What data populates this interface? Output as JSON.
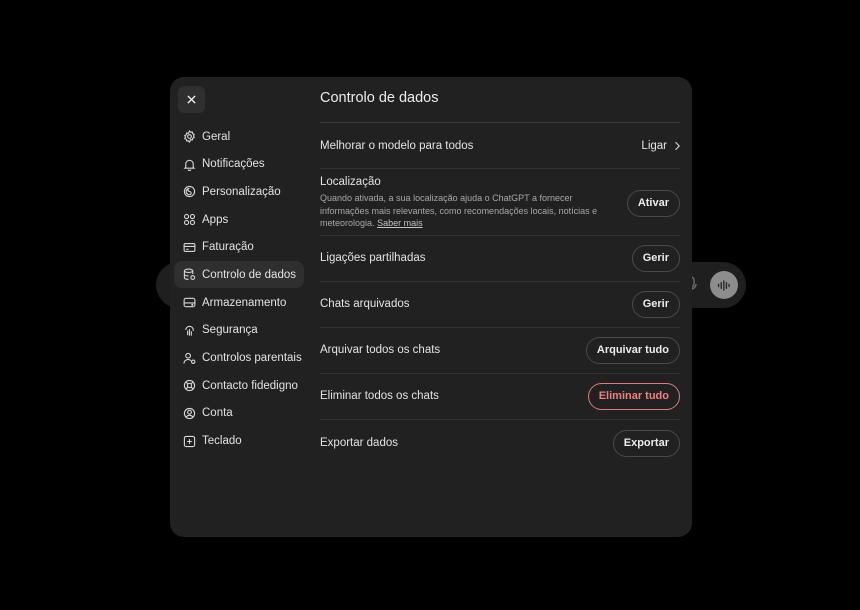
{
  "modal": {
    "title": "Controlo de dados"
  },
  "sidebar": {
    "items": [
      {
        "label": "Geral",
        "icon": "gear-icon"
      },
      {
        "label": "Notificações",
        "icon": "bell-icon"
      },
      {
        "label": "Personalização",
        "icon": "personalization-icon"
      },
      {
        "label": "Apps",
        "icon": "apps-grid-icon"
      },
      {
        "label": "Faturação",
        "icon": "credit-card-icon"
      },
      {
        "label": "Controlo de dados",
        "icon": "database-icon",
        "active": true
      },
      {
        "label": "Armazenamento",
        "icon": "storage-icon"
      },
      {
        "label": "Segurança",
        "icon": "security-icon"
      },
      {
        "label": "Controlos parentais",
        "icon": "parental-icon"
      },
      {
        "label": "Contacto fidedigno",
        "icon": "lifebuoy-icon"
      },
      {
        "label": "Conta",
        "icon": "account-icon"
      },
      {
        "label": "Teclado",
        "icon": "keyboard-icon"
      }
    ]
  },
  "settings": {
    "improve_model": {
      "label": "Melhorar o modelo para todos",
      "value": "Ligar"
    },
    "location": {
      "title": "Localização",
      "description": "Quando ativada, a sua localização ajuda o ChatGPT a fornecer informações mais relevantes, como recomendações locais, notícias e meteorologia.",
      "learn_more": "Saber mais",
      "button": "Ativar"
    },
    "shared_links": {
      "label": "Ligações partilhadas",
      "button": "Gerir"
    },
    "archived_chats": {
      "label": "Chats arquivados",
      "button": "Gerir"
    },
    "archive_all": {
      "label": "Arquivar todos os chats",
      "button": "Arquivar tudo"
    },
    "delete_all": {
      "label": "Eliminar todos os chats",
      "button": "Eliminar tudo"
    },
    "export": {
      "label": "Exportar dados",
      "button": "Exportar"
    }
  },
  "colors": {
    "background": "#000000",
    "modal": "#212121",
    "danger": "#ef7f82"
  }
}
